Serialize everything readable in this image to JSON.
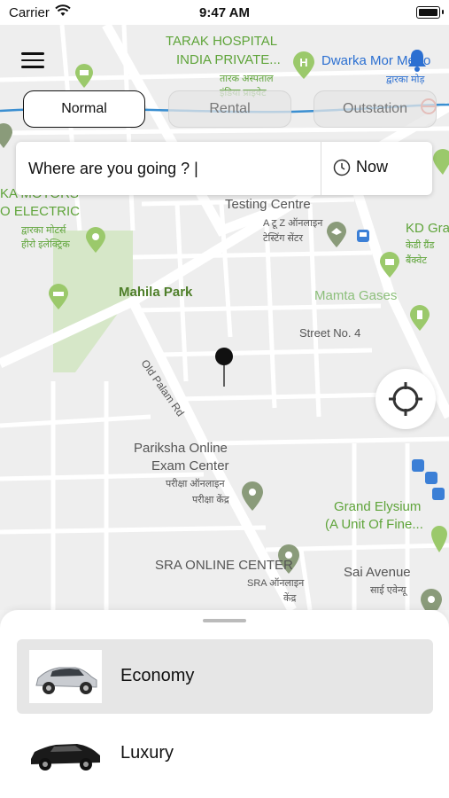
{
  "status_bar": {
    "carrier": "Carrier",
    "time": "9:47 AM"
  },
  "map": {
    "labels": {
      "tarak1": "TARAK HOSPITAL",
      "tarak2": "INDIA PRIVATE...",
      "tarak_hi1": "तारक अस्पताल",
      "tarak_hi2": "इंडिया प्राइवेट",
      "dwarka": "Dwarka Mor Metro",
      "dwarka_hi": "द्वारका मोड़",
      "motors1": "KA MOTORS",
      "motors2": "O ELECTRIC",
      "motors_hi1": "द्वारका मोटर्स",
      "motors_hi2": "हीरो इलेक्ट्रिक",
      "testing": "Testing Centre",
      "testing_hi1": "A टू Z ऑनलाइन",
      "testing_hi2": "टेस्टिंग सेंटर",
      "kd": "KD Gra",
      "kd_hi1": "केडी ग्रैंड",
      "kd_hi2": "बैंक्वेट",
      "mahila": "Mahila Park",
      "mamta": "Mamta Gases",
      "street4": "Street No. 4",
      "palam": "Old Palam Rd",
      "pariksha1": "Pariksha Online",
      "pariksha2": "Exam Center",
      "pariksha_hi1": "परीक्षा ऑनलाइन",
      "pariksha_hi2": "परीक्षा केंद्र",
      "grand1": "Grand Elysium",
      "grand2": "(A Unit Of Fine...",
      "sra": "SRA ONLINE CENTER",
      "sra_hi1": "SRA ऑनलाइन",
      "sra_hi2": "केंद्र",
      "sai": "Sai Avenue",
      "sai_hi": "साई एवेन्यू"
    }
  },
  "tabs": [
    "Normal",
    "Rental",
    "Outstation"
  ],
  "search": {
    "placeholder": "Where are you going ? |",
    "time_label": "Now"
  },
  "rides": [
    {
      "label": "Economy",
      "selected": true
    },
    {
      "label": "Luxury",
      "selected": false
    }
  ],
  "colors": {
    "map_green_label": "#5fa43a",
    "metro_blue": "#2b6fd1",
    "route_line": "#3b8fd1"
  }
}
